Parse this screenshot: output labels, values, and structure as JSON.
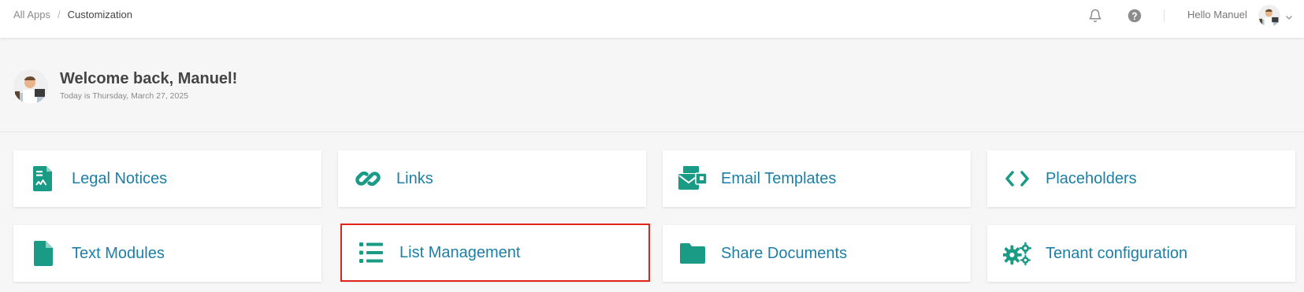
{
  "breadcrumb": {
    "root": "All Apps",
    "separator": "/",
    "current": "Customization"
  },
  "header": {
    "greeting": "Hello Manuel",
    "icons": [
      "bell-icon",
      "help-icon",
      "chevron-down-icon"
    ]
  },
  "welcome": {
    "title": "Welcome back, Manuel!",
    "date": "Today is Thursday, March 27, 2025"
  },
  "tiles": [
    {
      "label": "Legal Notices",
      "icon": "document-icon",
      "selected": false
    },
    {
      "label": "Links",
      "icon": "link-icon",
      "selected": false
    },
    {
      "label": "Email Templates",
      "icon": "email-template-icon",
      "selected": false
    },
    {
      "label": "Placeholders",
      "icon": "code-icon",
      "selected": false
    },
    {
      "label": "Text Modules",
      "icon": "file-icon",
      "selected": false
    },
    {
      "label": "List Management",
      "icon": "list-icon",
      "selected": true
    },
    {
      "label": "Share Documents",
      "icon": "folder-icon",
      "selected": false
    },
    {
      "label": "Tenant configuration",
      "icon": "gears-icon",
      "selected": false
    }
  ],
  "colors": {
    "accent": "#1d7ea6",
    "icon": "#1a9b86",
    "selection": "#e2231a",
    "background": "#f6f6f6"
  }
}
